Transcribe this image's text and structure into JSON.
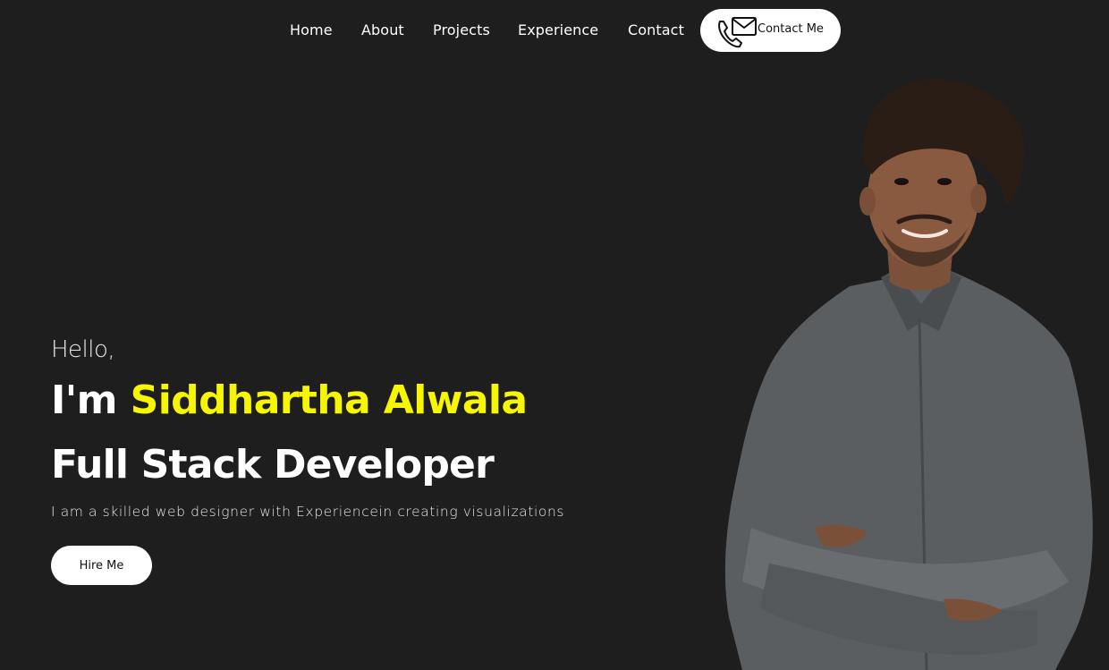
{
  "nav": {
    "items": [
      {
        "label": "Home"
      },
      {
        "label": "About"
      },
      {
        "label": "Projects"
      },
      {
        "label": "Experience"
      },
      {
        "label": "Contact"
      }
    ],
    "contact_button": {
      "label": "Contact Me",
      "icon": "mail-phone-icon"
    }
  },
  "hero": {
    "greeting": "Hello,",
    "name_prefix": "I'm ",
    "name": "Siddhartha Alwala",
    "role": "Full Stack Developer",
    "tagline": "I am a skilled web designer with Experiencein creating visualizations",
    "hire_button": "Hire Me"
  },
  "colors": {
    "background": "#1e1e1f",
    "accent": "#f6f600",
    "text": "#ffffff",
    "button_bg": "#ffffff"
  }
}
